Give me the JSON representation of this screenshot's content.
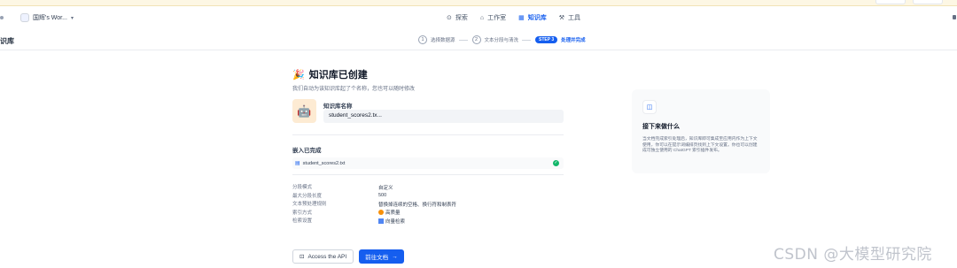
{
  "navbar": {
    "workspace_label": "国辉's Wor...",
    "tabs": [
      {
        "label": "探索",
        "icon": "compass-icon"
      },
      {
        "label": "工作室",
        "icon": "studio-icon"
      },
      {
        "label": "知识库",
        "icon": "book-icon",
        "active": true
      },
      {
        "label": "工具",
        "icon": "tool-icon"
      }
    ]
  },
  "subbar": {
    "crumb": "识库",
    "steps": [
      {
        "num": "1",
        "label": "选择数据源"
      },
      {
        "num": "2",
        "label": "文本分段与清洗"
      },
      {
        "num": "STEP 3",
        "label": "处理并完成",
        "active": true
      }
    ]
  },
  "main": {
    "emoji": "🎉",
    "title": "知识库已创建",
    "subtitle": "我们自动为该知识库起了个名称，您也可以随时修改",
    "kb_name_label": "知识库名称",
    "kb_name_value": "student_scores2.tx...",
    "embed_title": "嵌入已完成",
    "file_name": "student_scores2.txt",
    "meta": [
      {
        "key": "分段模式",
        "value": "自定义"
      },
      {
        "key": "最大分段长度",
        "value": "500"
      },
      {
        "key": "文本预处理规则",
        "value": "替换掉连续的空格、换行符和制表符"
      },
      {
        "key": "索引方式",
        "value": "高质量"
      },
      {
        "key": "检索设置",
        "value": "向量检索"
      }
    ],
    "api_button": "Access the API",
    "doc_button": "前往文档",
    "doc_arrow": "→"
  },
  "side": {
    "title": "接下来做什么",
    "body": "当文档完成索引处理后，知识库即可集成至应用内作为上下文使用，你可以在提示词编排页找到上下文设置。你也可以创建成可独立使用的 ChatGPT 索引插件发布。"
  },
  "watermark": "CSDN @大模型研究院",
  "colors": {
    "accent": "#155eef",
    "success": "#12b76a",
    "warning": "#f79009"
  }
}
